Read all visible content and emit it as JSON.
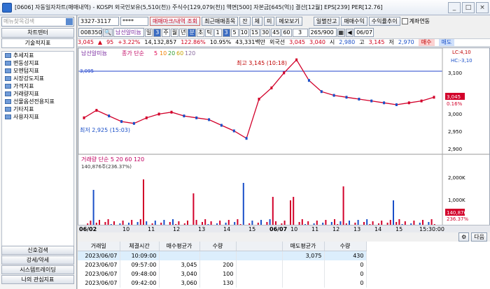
{
  "title": "[0606] 자동일자차트(매매내역) - KOSPI 외국인보유(5,510(천)) 주식수[129,079(천)] 액면[500] 자본금[645(억)] 결산[12월] EPS[239] PER[12.76]",
  "window": {
    "min": "_",
    "max": "□",
    "close": "×"
  },
  "sidebar": {
    "search_placeholder": "메뉴찾목검색",
    "tab_chart": "차트텐터",
    "tab_tech": "기술적지표",
    "items": [
      "추세지표",
      "변동성지표",
      "모멘텀지표",
      "시장강도지표",
      "가격지표",
      "거래량지표",
      "선물옵션전용지표",
      "기타지표",
      "사용자지표"
    ],
    "bottom": [
      "신호검색",
      "강세/약세",
      "시스템트레이딩",
      "나의 관심지표"
    ]
  },
  "toolbar": {
    "code": "3327-3117",
    "password": "****",
    "trade_view": "매매마크/내역 조회",
    "recent": "최근매매종목",
    "tabs": [
      "잔",
      "체",
      "미"
    ],
    "memo": "메모보기",
    "daily": "일별잔고",
    "profit": "매매수익",
    "profit_trend": "수익률추이",
    "account_link": "계좌연동"
  },
  "toolbar2": {
    "stock_code": "008350",
    "stock_name": "남선알미늄",
    "periods": [
      "일",
      "3",
      "주",
      "월",
      "년",
      "분",
      "초",
      "틱",
      "1",
      "3",
      "5",
      "10",
      "15",
      "30",
      "45",
      "60",
      "3"
    ],
    "count": "265/900",
    "date": "06/07"
  },
  "info": {
    "price": "3,045",
    "change": "95",
    "change_pct": "+3.22%",
    "volume": "14,132,857",
    "vol_pct": "122.86%",
    "turnover": "10.95%",
    "amount": "43,331백만",
    "foreign": "외국선",
    "p1": "3,045",
    "p2": "3,040",
    "open_label": "시",
    "open": "2,980",
    "high_label": "고",
    "high": "3,145",
    "low_label": "저",
    "low": "2,970",
    "buy": "매수",
    "sell": "매도"
  },
  "chart": {
    "legend_name": "남선알미늄",
    "legend_ma": "종가 단순",
    "ma_periods": [
      "5",
      "10",
      "20",
      "60",
      "120"
    ],
    "high_label": "최고 3,145 (10:18)",
    "low_label": "최저 2,925 (15:03)",
    "price_axis": [
      "3,100",
      "3,050",
      "3,000",
      "2,950",
      "2,900"
    ],
    "lc": "LC:4,10",
    "hc": "HC:-3,10",
    "cur_price": "3,045",
    "cur_pct": "0.16%",
    "level_label": "3,095",
    "vol_legend": "거래량 단순 5 20 60 120",
    "vol_value": "140,876주(236.37%)",
    "vol_axis": [
      "2,000K",
      "1,000K"
    ],
    "vol_cur": "140,876",
    "vol_cur_pct": "236.37%",
    "time_labels": [
      "06/02",
      "10",
      "11",
      "12",
      "13",
      "14",
      "15",
      "06/07",
      "10",
      "11",
      "12",
      "13",
      "14",
      "15"
    ],
    "end_time": "15:30:00"
  },
  "chart_data": {
    "type": "line",
    "series": [
      {
        "name": "남선알미늄",
        "values": [
          2990,
          3010,
          2995,
          2980,
          2975,
          2990,
          3000,
          3005,
          2995,
          2990,
          2985,
          2970,
          2955,
          2935,
          3040,
          3070,
          3110,
          3145,
          3090,
          3060,
          3050,
          3045,
          3040,
          3035,
          3030,
          3025,
          3030,
          3035,
          3045
        ]
      }
    ],
    "ylim": [
      2900,
      3150
    ]
  },
  "grid": {
    "headers": [
      "거래일",
      "체결시간",
      "매수평균가",
      "수량",
      "",
      "매도평균가",
      "수량"
    ],
    "rows": [
      [
        "2023/06/07",
        "10:09:00",
        "",
        "",
        "",
        "3,075",
        "430"
      ],
      [
        "2023/06/07",
        "09:57:00",
        "3,045",
        "200",
        "",
        "",
        "0"
      ],
      [
        "2023/06/07",
        "09:48:00",
        "3,040",
        "100",
        "",
        "",
        "0"
      ],
      [
        "2023/06/07",
        "09:42:00",
        "3,060",
        "130",
        "",
        "",
        "0"
      ]
    ],
    "next": "다음"
  }
}
